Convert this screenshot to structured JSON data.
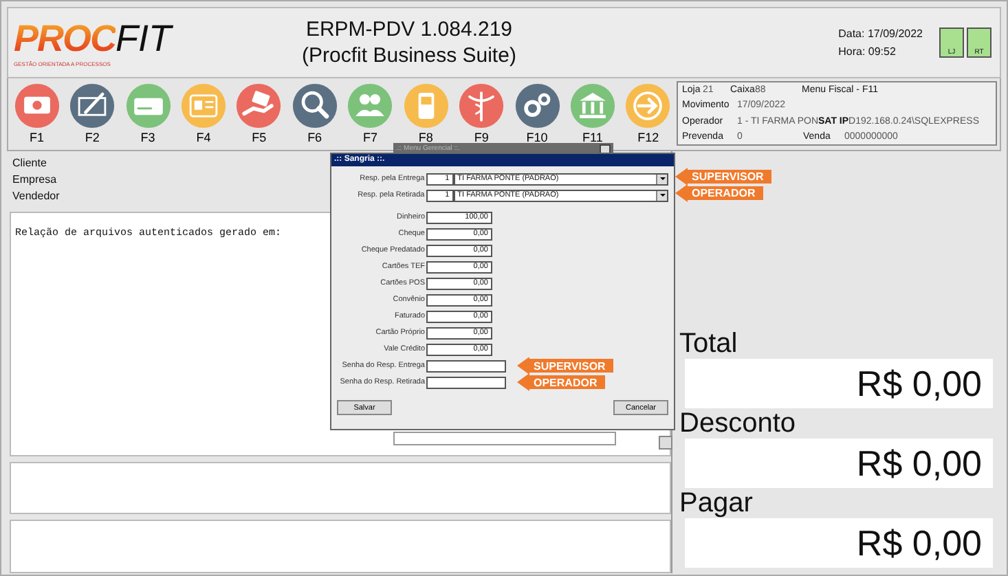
{
  "header": {
    "logo_main": "PROC",
    "logo_accent": "FIT",
    "logo_tagline": "GESTÃO ORIENTADA A PROCESSOS",
    "title_line1": "ERPM-PDV  1.084.219",
    "title_line2": "(Procfit Business Suite)",
    "date_label": "Data:",
    "date": "17/09/2022",
    "time_label": "Hora:",
    "time": "09:52",
    "indicators": [
      {
        "label": "LJ"
      },
      {
        "label": "RT"
      }
    ]
  },
  "toolbar": [
    {
      "key": "F1",
      "kind": "money",
      "color": "#ea6a5f"
    },
    {
      "key": "F2",
      "kind": "pen",
      "color": "#5c7083"
    },
    {
      "key": "F3",
      "kind": "card",
      "color": "#7cc27b"
    },
    {
      "key": "F4",
      "kind": "idcard",
      "color": "#f7bb4d"
    },
    {
      "key": "F5",
      "kind": "hand",
      "color": "#ea6a5f"
    },
    {
      "key": "F6",
      "kind": "search",
      "color": "#5c7083"
    },
    {
      "key": "F7",
      "kind": "people",
      "color": "#7cc27b"
    },
    {
      "key": "F8",
      "kind": "phone",
      "color": "#f7bb4d"
    },
    {
      "key": "F9",
      "kind": "caduceus",
      "color": "#ea6a5f"
    },
    {
      "key": "F10",
      "kind": "gears",
      "color": "#5c7083"
    },
    {
      "key": "F11",
      "kind": "bank",
      "color": "#7cc27b"
    },
    {
      "key": "F12",
      "kind": "arrow",
      "color": "#f7bb4d"
    }
  ],
  "info": {
    "loja_label": "Loja",
    "loja": "21",
    "caixa_label": "Caixa",
    "caixa": "88",
    "menu": "Menu Fiscal - F11",
    "movimento_label": "Movimento",
    "movimento": "17/09/2022",
    "operador_label": "Operador",
    "operador": "1 - TI FARMA PON",
    "sat_label": "SAT IP",
    "sat": "D192.168.0.24\\SQLEXPRESS",
    "prevenda_label": "Prevenda",
    "prevenda": "0",
    "venda_label": "Venda",
    "venda": "0000000000"
  },
  "customer_lines": [
    "Cliente",
    "Empresa",
    "Vendedor"
  ],
  "log_text": "Relação de arquivos autenticados gerado em:",
  "totals": [
    {
      "label": "Total",
      "value": "R$ 0,00"
    },
    {
      "label": "Desconto",
      "value": "R$ 0,00"
    },
    {
      "label": "Pagar",
      "value": "R$ 0,00"
    }
  ],
  "background_window": {
    "title": ".:: Menu Gerencial ::."
  },
  "dialog": {
    "title": ".:: Sangria ::.",
    "responsibles": [
      {
        "label": "Resp. pela  Entrega",
        "code": "1",
        "name": "TI FARMA PONTE (PADRAO)",
        "callout": "SUPERVISOR"
      },
      {
        "label": "Resp. pela Retirada",
        "code": "1",
        "name": "TI FARMA PONTE (PADRAO)",
        "callout": "OPERADOR"
      }
    ],
    "amounts": [
      {
        "label": "Dinheiro",
        "value": "100,00"
      },
      {
        "label": "Cheque",
        "value": "0,00"
      },
      {
        "label": "Cheque Predatado",
        "value": "0,00"
      },
      {
        "label": "Cartões TEF",
        "value": "0,00"
      },
      {
        "label": "Cartões POS",
        "value": "0,00"
      },
      {
        "label": "Convênio",
        "value": "0,00"
      },
      {
        "label": "Faturado",
        "value": "0,00"
      },
      {
        "label": "Cartão Próprio",
        "value": "0,00"
      },
      {
        "label": "Vale Crédito",
        "value": "0,00"
      }
    ],
    "passwords": [
      {
        "label": "Senha do Resp. Entrega",
        "callout": "SUPERVISOR"
      },
      {
        "label": "Senha do Resp. Retirada",
        "callout": "OPERADOR"
      }
    ],
    "buttons": [
      "Salvar",
      "Cancelar"
    ]
  }
}
